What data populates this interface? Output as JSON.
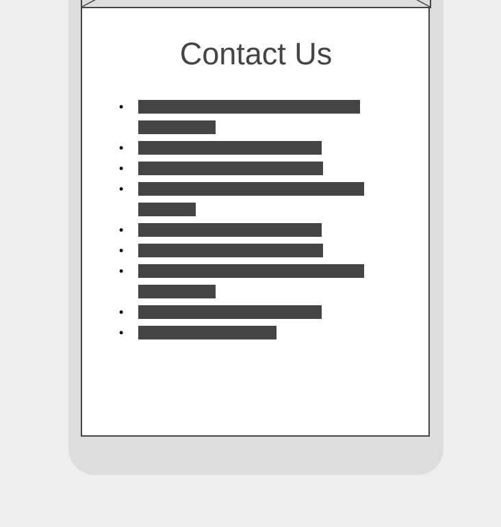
{
  "page": {
    "title": "Contact Us"
  },
  "contact_list": {
    "bullet": "•",
    "items": [
      {
        "lines": [
          0.72,
          0.25
        ]
      },
      {
        "lines": [
          0.595
        ]
      },
      {
        "lines": [
          0.6
        ]
      },
      {
        "lines": [
          0.733,
          0.187
        ]
      },
      {
        "lines": [
          0.595
        ]
      },
      {
        "lines": [
          0.6
        ]
      },
      {
        "lines": [
          0.733,
          0.25
        ]
      },
      {
        "lines": [
          0.595
        ]
      },
      {
        "lines": [
          0.449
        ]
      }
    ]
  },
  "colors": {
    "page_background": "#eeeeee",
    "device_frame": "#dddddd",
    "screen_background": "#ffffff",
    "ink": "#444444"
  }
}
